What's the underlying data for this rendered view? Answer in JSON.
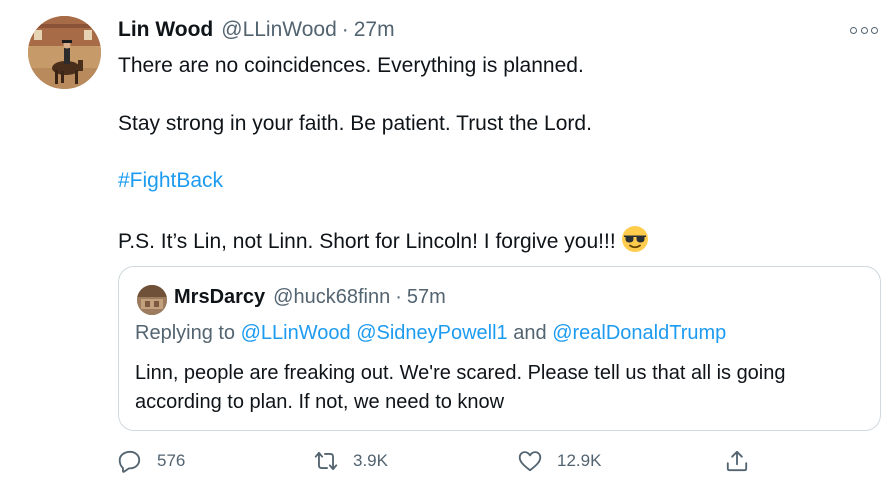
{
  "tweet": {
    "author_name": "Lin Wood",
    "author_handle": "@LLinWood",
    "separator": "·",
    "time": "27m",
    "lines": [
      "There are no coincidences. Everything is planned.",
      "Stay strong in your faith. Be patient. Trust the Lord.",
      "#FightBack",
      "P.S. It’s Lin, not Linn. Short for Lincoln! I forgive you!!!"
    ],
    "emoji": "smiling-face-with-sunglasses",
    "colors": {
      "link": "#1d9bf0",
      "secondary": "#536471",
      "text": "#0f1419",
      "border": "#cfd9de"
    }
  },
  "quote": {
    "author_name": "MrsDarcy",
    "author_handle": "@huck68finn",
    "separator": "·",
    "time": "57m",
    "replying_prefix": "Replying to",
    "mention1": "@LLinWood",
    "mention2": "@SidneyPowell1",
    "conjunction": "and",
    "mention3": "@realDonaldTrump",
    "body": "Linn, people are freaking out. We're scared. Please tell us that all is going according to plan. If not, we need to know"
  },
  "actions": {
    "reply_count": "576",
    "retweet_count": "3.9K",
    "like_count": "12.9K",
    "share_icon": "share-icon"
  }
}
